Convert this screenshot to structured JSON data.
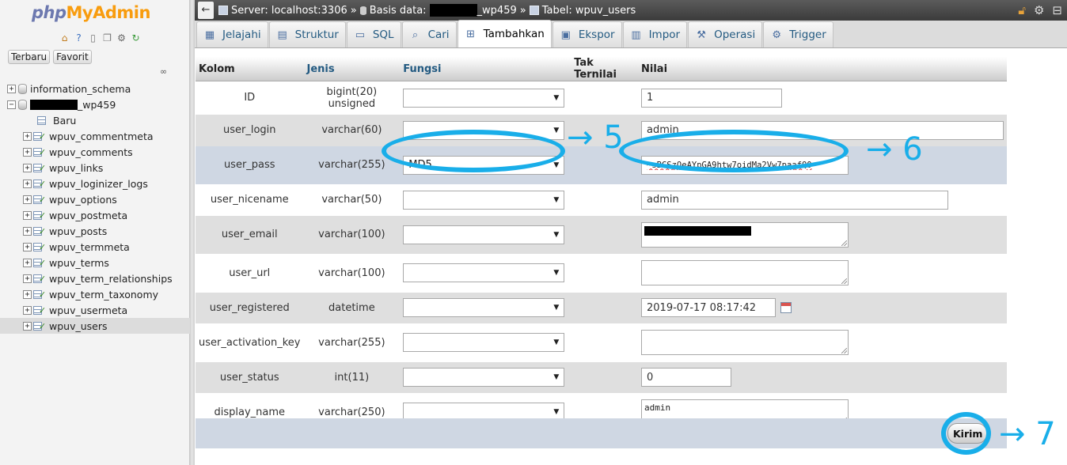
{
  "app": {
    "logo_php": "php",
    "logo_myadmin": "MyAdmin"
  },
  "sidebar": {
    "buttons": [
      "Terbaru",
      "Favorit"
    ],
    "logo_icons": [
      "home-icon",
      "help-icon",
      "docs-icon",
      "copy-icon",
      "settings-icon",
      "reload-icon"
    ],
    "databases": [
      {
        "name": "information_schema"
      },
      {
        "name_suffix": "_wp459"
      }
    ],
    "new_label": "Baru",
    "tables": [
      "wpuv_commentmeta",
      "wpuv_comments",
      "wpuv_links",
      "wpuv_loginizer_logs",
      "wpuv_options",
      "wpuv_postmeta",
      "wpuv_posts",
      "wpuv_termmeta",
      "wpuv_terms",
      "wpuv_term_relationships",
      "wpuv_term_taxonomy",
      "wpuv_usermeta",
      "wpuv_users"
    ],
    "active_table": "wpuv_users"
  },
  "breadcrumb": {
    "server": "Server: localhost:3306",
    "sep": "»",
    "db_prefix": "Basis data:",
    "db_suffix": "_wp459",
    "table": "Tabel: wpuv_users"
  },
  "tabs": [
    {
      "label": "Jelajahi",
      "icon": "browse-icon"
    },
    {
      "label": "Struktur",
      "icon": "structure-icon"
    },
    {
      "label": "SQL",
      "icon": "sql-icon"
    },
    {
      "label": "Cari",
      "icon": "search-icon"
    },
    {
      "label": "Tambahkan",
      "icon": "insert-icon",
      "active": true
    },
    {
      "label": "Ekspor",
      "icon": "export-icon"
    },
    {
      "label": "Impor",
      "icon": "import-icon"
    },
    {
      "label": "Operasi",
      "icon": "wrench-icon"
    },
    {
      "label": "Trigger",
      "icon": "trigger-icon"
    }
  ],
  "table": {
    "headers": {
      "column": "Kolom",
      "type": "Jenis",
      "function": "Fungsi",
      "null": "Tak Ternilai",
      "value": "Nilai"
    },
    "rows": [
      {
        "name": "ID",
        "type": "bigint(20) unsigned",
        "function": "",
        "value": "1"
      },
      {
        "name": "user_login",
        "type": "varchar(60)",
        "function": "",
        "value": "admin"
      },
      {
        "name": "user_pass",
        "type": "varchar(255)",
        "function": "MD5",
        "value": "~sBGSzOeAYpGA9htw7oidMa2Vw7paafQ0"
      },
      {
        "name": "user_nicename",
        "type": "varchar(50)",
        "function": "",
        "value": "admin"
      },
      {
        "name": "user_email",
        "type": "varchar(100)",
        "function": "",
        "value": ""
      },
      {
        "name": "user_url",
        "type": "varchar(100)",
        "function": "",
        "value": ""
      },
      {
        "name": "user_registered",
        "type": "datetime",
        "function": "",
        "value": "2019-07-17 08:17:42"
      },
      {
        "name": "user_activation_key",
        "type": "varchar(255)",
        "function": "",
        "value": ""
      },
      {
        "name": "user_status",
        "type": "int(11)",
        "function": "",
        "value": "0"
      },
      {
        "name": "display_name",
        "type": "varchar(250)",
        "function": "",
        "value": "admin"
      }
    ]
  },
  "submit_label": "Kirim",
  "annotations": {
    "step5": "→ 5",
    "step6": "→ 6",
    "step7": "→ 7",
    "color": "#19aee9"
  }
}
